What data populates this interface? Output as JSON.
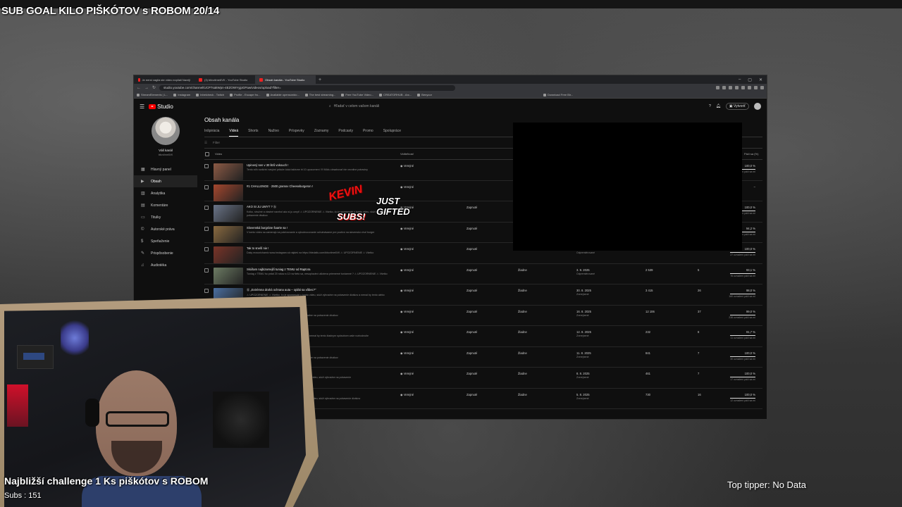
{
  "overlay": {
    "title": "SUB GOAL KILO PIŠKÓTOV s ROBOM 20/14",
    "challenge": "Najbližší challenge 1 Ks piškótov s ROBOM",
    "subs": "Subs : 151",
    "top_tipper": "Top tipper: No Data"
  },
  "alert": {
    "name": "KEVIN",
    "just_gifted": "JUST GIFTED",
    "subs": "SUBS!"
  },
  "browser": {
    "tabs": [
      {
        "label": "Je eerst vagila ste video ezpliali Navrijl"
      },
      {
        "label": "(3) bitovtime6VK - YouTube Studio"
      },
      {
        "label": "Obsah kanála - YouTube Studio"
      }
    ],
    "url": "studio.youtube.com/channel/UCP7sakWpn-4EZOWYyjpGPaw/videos/upload?filter=",
    "bookmarks": [
      "StreamElements | L...",
      "Instagram",
      "Inbelcheck - Twitch",
      "Profile - Escape fro...",
      "Available opensonido...",
      "The best streaming...",
      "Free YouTube Video...",
      "CREATORHUB - Arc...",
      "Benycor",
      "Download Free Bir..."
    ]
  },
  "studio": {
    "logo": "Studio",
    "search_placeholder": "Hľadať v celom vašom kanáli",
    "create_label": "Vytvoriť",
    "channel_name": "Váš kanál",
    "channel_handle": "bitovtime6VK",
    "menu": [
      {
        "icon": "dashboard-icon",
        "glyph": "▦",
        "label": "Hlavný panel"
      },
      {
        "icon": "content-icon",
        "glyph": "▶",
        "label": "Obsah"
      },
      {
        "icon": "analytics-icon",
        "glyph": "▥",
        "label": "Analytika"
      },
      {
        "icon": "comments-icon",
        "glyph": "▤",
        "label": "Komentáre"
      },
      {
        "icon": "subtitles-icon",
        "glyph": "▭",
        "label": "Titulky"
      },
      {
        "icon": "copyright-icon",
        "glyph": "©",
        "label": "Autorské práva"
      },
      {
        "icon": "earn-icon",
        "glyph": "$",
        "label": "Speňaženie"
      },
      {
        "icon": "customize-icon",
        "glyph": "✎",
        "label": "Prispôsobenie"
      },
      {
        "icon": "audio-library-icon",
        "glyph": "♫",
        "label": "Audiotéka"
      }
    ],
    "page_title": "Obsah kanála",
    "content_tabs": [
      "Inšpirácia",
      "Videá",
      "Shorts",
      "Naživo",
      "Príspevky",
      "Zoznamy",
      "Podcasty",
      "Promo",
      "Spolupráce"
    ],
    "active_tab": "Videá",
    "filter_label": "Filter",
    "columns": {
      "video": "Video",
      "visibility": "Viditeľnosť",
      "comments": "Komentáre",
      "likes": "Páči sa (%)"
    },
    "rows": [
      {
        "title": "Upinený sen v 30 litrů vokouch !",
        "desc": "Tento stíh rozšíriní navýmí pritože čoká takisme tri 10 upozornení !!!! Môžu obsahovať nie vecnilne potraviny",
        "visibility": "Verejné",
        "monetization": "",
        "restrictions": "",
        "date": "",
        "date_sub": "",
        "views": "",
        "comments": "6",
        "likes": "100,0 %",
        "likes_sub": "17 označení páči sa mi",
        "thumb": "#8c5a45"
      },
      {
        "title": "#1 CHALLENGE · 2500 gramov Cheeseburgeron !",
        "desc": "",
        "visibility": "Verejné",
        "monetization": "",
        "restrictions": "",
        "date": "",
        "date_sub": "",
        "views": "",
        "comments": "0",
        "likes": "–",
        "likes_sub": "",
        "thumb": "#a5472e"
      },
      {
        "title": "AKO SI JU UMYT ? ⓑ",
        "desc": "Kolko, stružné a vlastné navrhol ako si ju umyt! ⚠ UPOZORNENIE ⚠ Všetko, čo je spomenuté v tomto videu, slúži výhradne na pobavenie divákov",
        "visibility": "Verejné",
        "monetization": "Zapnuté",
        "restrictions": "Žiadne",
        "date": "13. 9. 2025",
        "date_sub": "Odpremiérované",
        "views": "292",
        "comments": "7",
        "likes": "100,0 %",
        "likes_sub": "17 označení páči sa mi",
        "thumb": "#6a7488"
      },
      {
        "title": "Slovenská burgráne šaarte sa !",
        "desc": "V tomto videu sa zamerajú na pokrizovanie a vyhodnocovanie ochutnávame pre poctivú na slovenskú chuť burger",
        "visibility": "Verejné",
        "monetization": "Zapnuté",
        "restrictions": "Žiadne",
        "date": "10. 9. 2025",
        "date_sub": "Odpremiérované",
        "views": "470",
        "comments": "8",
        "likes": "94,2 %",
        "likes_sub": "33 označení páči sa mi",
        "thumb": "#8a6a40"
      },
      {
        "title": "Tak to sneší nie !",
        "desc": "Daky rezourichamic www.instagram.sk nájdeš na https://hledaltu.com/bitovtime6VK ⚠ UPOZORNENIE ⚠ Všetko",
        "visibility": "Verejné",
        "monetization": "Zapnuté",
        "restrictions": "Žiadne",
        "date": "5. 9. 2025",
        "date_sub": "Odpremiérované",
        "views": "491",
        "comments": "3",
        "likes": "100,0 %",
        "likes_sub": "27 označení páči sa mi",
        "thumb": "#7a3428"
      },
      {
        "title": "Skúšam najbizarnejší tuniag z TEMU od Raptora",
        "desc": "Tuniag z TEMU ho prdal 20 rokov a 12 rov tieto sa, nesupluvání ušloteva priemerné tuniamné ? ⚠ UPOZORNENIE ⚠ Všetko",
        "visibility": "Verejné",
        "monetization": "Zapnuté",
        "restrictions": "Žiadne",
        "date": "3. 9. 2025",
        "date_sub": "Odpremiérované",
        "views": "2 539",
        "comments": "5",
        "likes": "93,1 %",
        "likes_sub": "76 označení páči sa mi",
        "thumb": "#6d7c64"
      },
      {
        "title": "⓪ „Extrémna drahá ochrana auta – opláti sa vôbec?“",
        "desc": "⚠ UPOZORNENIE ⚠ Všetko, čo je spomenuté v tomto videu, slúži výhradne na pobavenie divákov a nemal by tento alebo komentár",
        "visibility": "Verejné",
        "monetization": "Zapnuté",
        "restrictions": "Žiadne",
        "date": "30. 8. 2025",
        "date_sub": "Zverejnené",
        "views": "3 415",
        "comments": "26",
        "likes": "98,0 %",
        "likes_sub": "160 označení páči sa mi",
        "thumb": "#4a6ea0"
      },
      {
        "title": "...eam ho už zničiť...",
        "desc": "...⚠ Všetko, čo je spomenuté v tomto videu, slúži výhradne na pobavenie divákov",
        "visibility": "Verejné",
        "monetization": "Zapnuté",
        "restrictions": "Žiadne",
        "date": "16. 8. 2025",
        "date_sub": "Zverejnené",
        "views": "12 106",
        "comments": "37",
        "likes": "99,0 %",
        "likes_sub": "238 označení páči sa mi",
        "thumb": "#333"
      },
      {
        "title": "...",
        "desc": "...v tomto videu, slúži výhradne na pobavenie divákov a nemal by tento žiadnym spôsobom vaše rozhodnutie",
        "visibility": "Verejné",
        "monetization": "Zapnuté",
        "restrictions": "Žiadne",
        "date": "12. 8. 2025",
        "date_sub": "Zverejnené",
        "views": "232",
        "comments": "8",
        "likes": "91,7 %",
        "likes_sub": "11 označení páči sa mi",
        "thumb": "#333"
      },
      {
        "title": "...ako ⓑ ⓑ",
        "desc": "...⚠ Všetko, čo je spomenuté v tomto videu, slúži výhradne na pobavenie divákov",
        "visibility": "Verejné",
        "monetization": "Zapnuté",
        "restrictions": "Žiadne",
        "date": "11. 8. 2025",
        "date_sub": "Zverejnené",
        "views": "841",
        "comments": "7",
        "likes": "100,0 %",
        "likes_sub": "30 označení páči sa mi",
        "thumb": "#333"
      },
      {
        "title": "...ládať som to ?",
        "desc": "...⚠ UPOZORNENIE ⚠ Všetko, čo je spomenuté v tomto videu, slúži výhradne na pobavenie",
        "visibility": "Verejné",
        "monetization": "Zapnuté",
        "restrictions": "Žiadne",
        "date": "8. 8. 2025",
        "date_sub": "Zverejnené",
        "views": "461",
        "comments": "7",
        "likes": "100,0 %",
        "likes_sub": "17 označení páči sa mi",
        "thumb": "#333"
      },
      {
        "title": "...tajný hoví mi stoiro podpáld kudiyda!",
        "desc": "...⚠ UPOZORNENIE ⚠ Všetko, čo je spomenuté v tomto videu, slúži výhradne na pobavenie divákov",
        "visibility": "Verejné",
        "monetization": "Zapnuté",
        "restrictions": "Žiadne",
        "date": "5. 8. 2025",
        "date_sub": "Zverejnené",
        "views": "730",
        "comments": "16",
        "likes": "100,0 %",
        "likes_sub": "12 označení páči sa mi",
        "thumb": "#333"
      }
    ]
  }
}
